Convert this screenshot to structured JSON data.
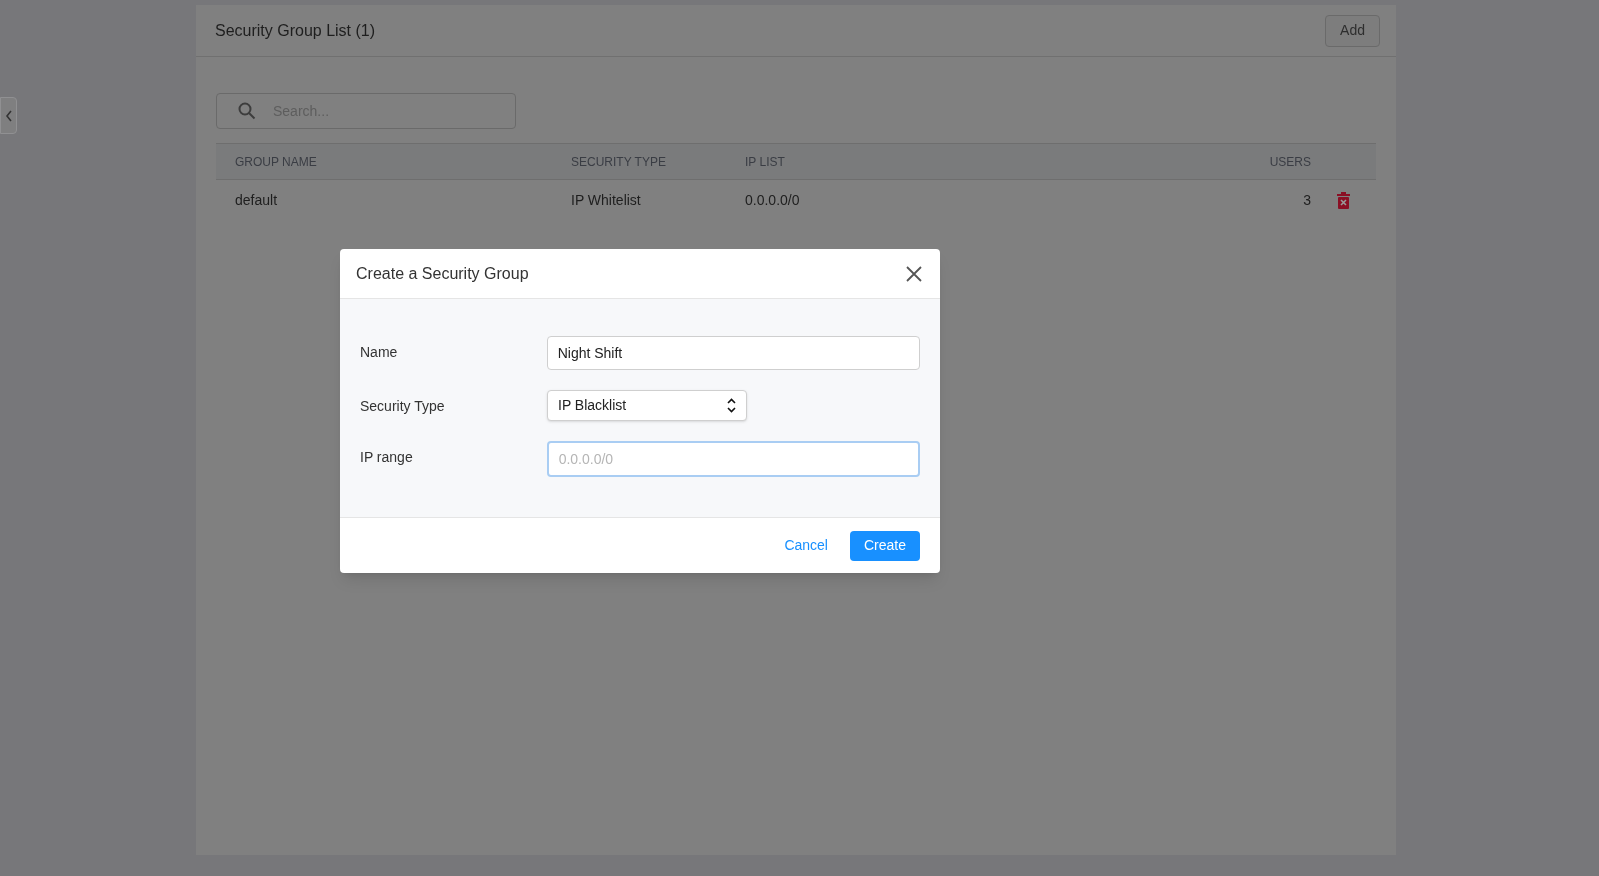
{
  "panel": {
    "title": "Security Group List (1)",
    "add_button": "Add"
  },
  "search": {
    "placeholder": "Search..."
  },
  "table": {
    "columns": [
      "GROUP NAME",
      "SECURITY TYPE",
      "IP LIST",
      "USERS"
    ],
    "rows": [
      {
        "group_name": "default",
        "security_type": "IP Whitelist",
        "ip_list": "0.0.0.0/0",
        "users": "3"
      }
    ]
  },
  "dialog": {
    "title": "Create a Security Group",
    "fields": [
      {
        "kind": "text",
        "label": "Name",
        "value": "Night Shift",
        "focused": false
      },
      {
        "kind": "select",
        "label": "Security Type",
        "value": "IP Blacklist",
        "focused": false
      },
      {
        "kind": "text",
        "label": "IP range",
        "placeholder": "0.0.0.0/0",
        "focused": true
      }
    ],
    "buttons": [
      {
        "kind": "link",
        "label": "Cancel"
      },
      {
        "kind": "primary",
        "label": "Create"
      }
    ]
  }
}
